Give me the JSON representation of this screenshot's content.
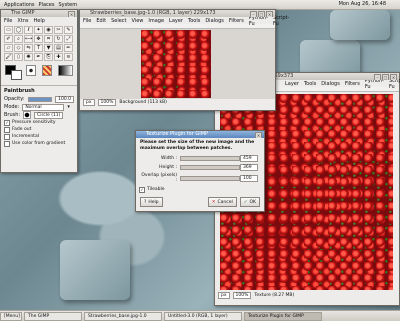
{
  "panel": {
    "menus": [
      "Applications",
      "Places",
      "System"
    ],
    "clock": "Mon Aug 26, 16:48"
  },
  "toolbox": {
    "title": "The GIMP",
    "menus": [
      "File",
      "Xtns",
      "Help"
    ],
    "tool_icons": [
      "rect-select",
      "ellipse-select",
      "free-select",
      "fuzzy-select",
      "color-select",
      "scissors",
      "paths",
      "color-picker",
      "zoom",
      "measure",
      "move",
      "crop",
      "rotate",
      "scale",
      "shear",
      "perspective",
      "flip",
      "text",
      "bucket-fill",
      "blend",
      "pencil",
      "paintbrush",
      "eraser",
      "airbrush",
      "ink",
      "clone",
      "heal",
      "smudge"
    ],
    "options_title": "Paintbrush",
    "opacity_label": "Opacity:",
    "opacity_value": "100.0",
    "opacity_fraction": 1.0,
    "mode_label": "Mode:",
    "mode_value": "Normal",
    "brush_label": "Brush:",
    "brush_value": "Circle (11)",
    "pressure_label": "Pressure sensitivity",
    "fade_label": "Fade out",
    "incremental_label": "Incremental",
    "gradient_label": "Use color from gradient"
  },
  "small_window": {
    "title": "Strawberries_base.jpg-1.0 (RGB, 1 layer) 229x173",
    "menus": [
      "File",
      "Edit",
      "Select",
      "View",
      "Image",
      "Layer",
      "Tools",
      "Dialogs",
      "Filters",
      "Python-Fu",
      "Script-Fu"
    ],
    "unit": "px",
    "zoom": "100%",
    "status": "Background (113 kB)"
  },
  "large_window": {
    "title": "3.0 (RGB, 1 layer) 459x373",
    "menus": [
      "Layer",
      "Tools",
      "Dialogs",
      "Filters",
      "Python-Fu",
      "Script-Fu"
    ],
    "unit": "px",
    "zoom": "100%",
    "status": "Texture (8.27 MB)"
  },
  "dialog": {
    "title": "Texturize Plugin for GIMP",
    "heading": "Please set the size of the new image and the maximum overlap between patches.",
    "width_label": "Width :",
    "width_value": "459",
    "height_label": "Height :",
    "height_value": "369",
    "overlap_label": "Overlap (pixels) :",
    "overlap_value": "100",
    "tileable_label": "Tileable",
    "help_label": "Help",
    "cancel_label": "Cancel",
    "ok_label": "OK"
  },
  "taskbar": {
    "tasks": [
      "[Menu]",
      "The GIMP",
      "Strawberries_base.jpg-1.0",
      "Untitled-3.0 (RGB, 1 layer)",
      "Texturize Plugin for GIMP"
    ]
  },
  "colors": {
    "title_active": "#5b86bf",
    "desktop": "#6f8d97",
    "strawberry": "#d61c1c"
  }
}
